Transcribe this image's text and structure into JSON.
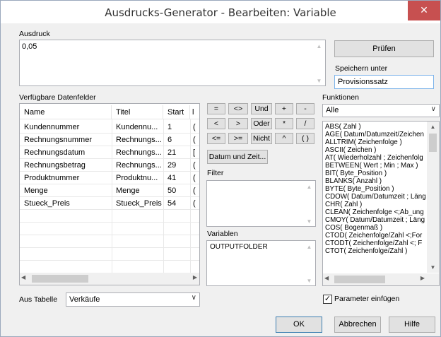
{
  "window": {
    "title": "Ausdrucks-Generator - Bearbeiten: Variable",
    "close_glyph": "✕"
  },
  "expression": {
    "group_label": "Ausdruck",
    "value": "0,05"
  },
  "check_button": "Prüfen",
  "save_as": {
    "label": "Speichern unter",
    "value": "Provisionssatz"
  },
  "fields": {
    "label": "Verfügbare Datenfelder",
    "columns": [
      "Name",
      "Titel",
      "Start",
      "l"
    ],
    "rows": [
      [
        "Kundennummer",
        "Kundennu...",
        "1",
        "("
      ],
      [
        "Rechnungsnummer",
        "Rechnungs...",
        "6",
        "("
      ],
      [
        "Rechnungsdatum",
        "Rechnungs...",
        "21",
        "["
      ],
      [
        "Rechnungsbetrag",
        "Rechnungs...",
        "29",
        "("
      ],
      [
        "Produktnummer",
        "Produktnu...",
        "41",
        "("
      ],
      [
        "Menge",
        "Menge",
        "50",
        "("
      ],
      [
        "Stueck_Preis",
        "Stueck_Preis",
        "54",
        "("
      ]
    ]
  },
  "operators": {
    "row1": [
      "=",
      "<>",
      "Und",
      "+",
      "-"
    ],
    "row2": [
      "<",
      ">",
      "Oder",
      "*",
      "/"
    ],
    "row3": [
      "<=",
      ">=",
      "Nicht",
      "^",
      "( )"
    ],
    "date_time": "Datum und Zeit..."
  },
  "filter_label": "Filter",
  "variables": {
    "label": "Variablen",
    "items": [
      "OUTPUTFOLDER"
    ]
  },
  "functions": {
    "label": "Funktionen",
    "category": "Alle",
    "items": [
      "ABS( Zahl )",
      "AGE( Datum/Datumzeit/Zeichen",
      "ALLTRIM( Zeichenfolge )",
      "ASCII( Zeichen )",
      "AT( Wiederholzahl ; Zeichenfolg",
      "BETWEEN( Wert ; Min ; Max )",
      "BIT( Byte_Position )",
      "BLANKS( Anzahl )",
      "BYTE( Byte_Position )",
      "CDOW( Datum/Datumzeit ; Läng",
      "CHR( Zahl )",
      "CLEAN( Zeichenfolge <;Ab_ung",
      "CMOY( Datum/Datumzeit ; Läng",
      "COS( Bogenmaß )",
      "CTOD( Zeichenfolge/Zahl <;For",
      "CTODT( Zeichenfolge/Zahl <; F",
      "CTOT( Zeichenfolge/Zahl )"
    ]
  },
  "table_select": {
    "label": "Aus Tabelle",
    "value": "Verkäufe"
  },
  "insert_params": {
    "label": "Parameter einfügen",
    "checked": true
  },
  "buttons": {
    "ok": "OK",
    "cancel": "Abbrechen",
    "help": "Hilfe"
  },
  "icons": {
    "up": "▲",
    "down": "▼",
    "left": "◀",
    "right": "▶",
    "chevron": "∨",
    "check": "✓"
  }
}
